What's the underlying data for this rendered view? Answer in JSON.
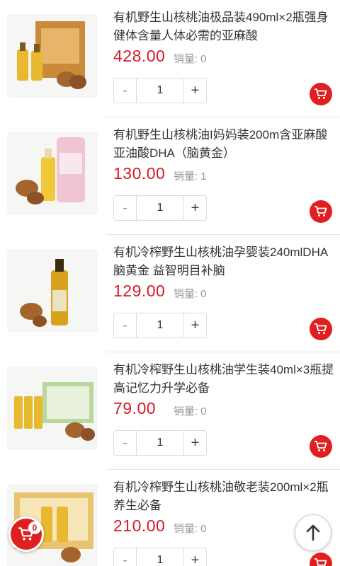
{
  "products": [
    {
      "title": "有机野生山核桃油极品装490ml×2瓶强身健体含量人体必需的亚麻酸",
      "price": "428.00",
      "sales_label": "销量:",
      "sales": "0",
      "quantity": "1",
      "minus": "-",
      "plus": "+"
    },
    {
      "title": "有机野生山核桃油I妈妈装200m含亚麻酸亚油酸DHA（脑黄金）",
      "price": "130.00",
      "sales_label": "销量:",
      "sales": "1",
      "quantity": "1",
      "minus": "-",
      "plus": "+"
    },
    {
      "title": "有机冷榨野生山核桃油孕婴装240mlDHA脑黄金 益智明目补脑",
      "price": "129.00",
      "sales_label": "销量:",
      "sales": "0",
      "quantity": "1",
      "minus": "-",
      "plus": "+"
    },
    {
      "title": "有机冷榨野生山核桃油学生装40ml×3瓶提高记忆力升学必备",
      "price": "79.00",
      "sales_label": "销量:",
      "sales": "0",
      "quantity": "1",
      "minus": "-",
      "plus": "+"
    },
    {
      "title": "有机冷榨野生山核桃油敬老装200ml×2瓶养生必备",
      "price": "210.00",
      "sales_label": "销量:",
      "sales": "0",
      "quantity": "1",
      "minus": "-",
      "plus": "+"
    }
  ],
  "floating_cart": {
    "count": "0",
    "icon": "cart-icon"
  },
  "back_to_top": {
    "icon": "arrow-up-icon"
  },
  "colors": {
    "price": "#d7182a",
    "accent": "#e02020",
    "muted": "#999999"
  }
}
